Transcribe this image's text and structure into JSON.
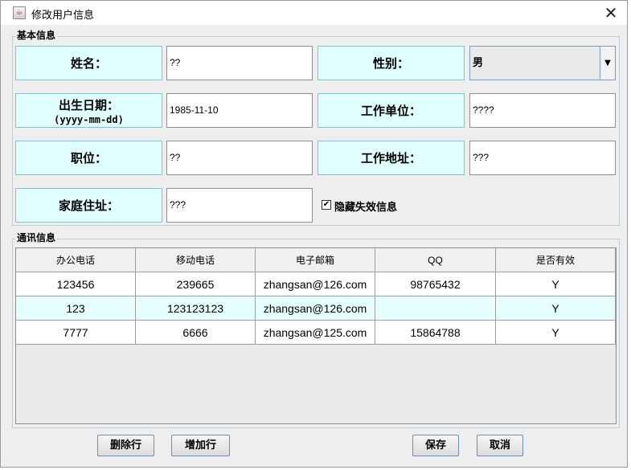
{
  "window": {
    "title": "修改用户信息",
    "icon": "java-app-icon",
    "close_glyph": "✕"
  },
  "basic_section": {
    "legend": "基本信息",
    "name": {
      "label": "姓名：",
      "value": "??"
    },
    "gender": {
      "label": "性别：",
      "value": "男"
    },
    "birth": {
      "label": "出生日期：",
      "format": "(yyyy-mm-dd)",
      "value": "1985-11-10"
    },
    "employer": {
      "label": "工作单位：",
      "value": "????"
    },
    "position": {
      "label": "职位：",
      "value": "??"
    },
    "work_address": {
      "label": "工作地址：",
      "value": "???"
    },
    "home_address": {
      "label": "家庭住址：",
      "value": "???"
    },
    "hide_invalid": {
      "label": "隐藏失效信息",
      "checked": true,
      "glyph": "✔"
    }
  },
  "contact_section": {
    "legend": "通讯信息",
    "columns": [
      "办公电话",
      "移动电话",
      "电子邮箱",
      "QQ",
      "是否有效"
    ],
    "rows": [
      [
        "123456",
        "239665",
        "zhangsan@126.com",
        "98765432",
        "Y"
      ],
      [
        "123",
        "123123123",
        "zhangsan@126.com",
        "",
        "Y"
      ],
      [
        "7777",
        "6666",
        "zhangsan@125.com",
        "15864788",
        "Y"
      ]
    ],
    "selected_row_index": 1
  },
  "buttons": {
    "delete_row": "删除行",
    "add_row": "增加行",
    "save": "保存",
    "cancel": "取消"
  },
  "colors": {
    "label_bg": "#e0ffff",
    "label_border": "#7ec3d8",
    "selected_row_bg": "#e6ffff",
    "group_border": "#b8cfe0"
  }
}
